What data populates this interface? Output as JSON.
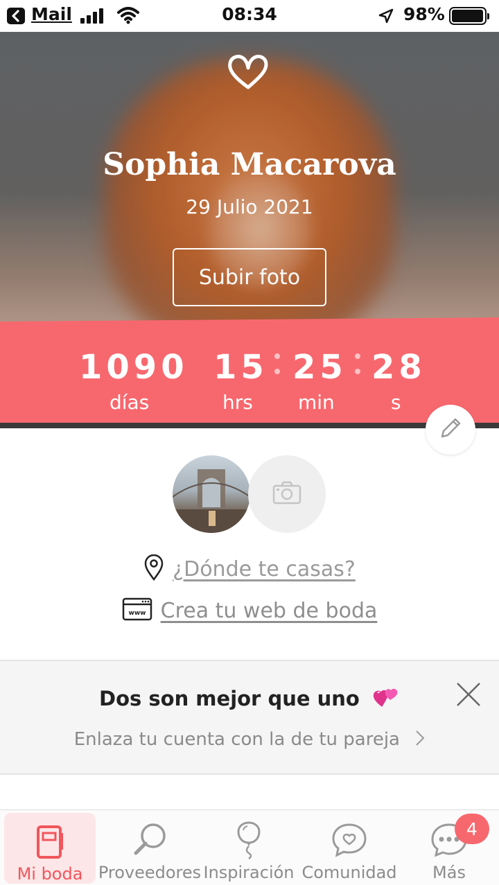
{
  "status_bar": {
    "back_app": "Mail",
    "time": "08:34",
    "battery": "98%",
    "battery_level": 0.98,
    "icons": [
      "back-arrow-icon",
      "signal-icon",
      "wifi-icon",
      "location-arrow-icon",
      "battery-icon"
    ]
  },
  "hero": {
    "name": "Sophia Macarova",
    "date": "29 Julio 2021",
    "upload_button": "Subir foto",
    "icon": "heart-outline-icon"
  },
  "countdown": {
    "days": "1090",
    "hours": "15",
    "minutes": "25",
    "seconds": "28",
    "days_label": "días",
    "hours_label": "hrs",
    "minutes_label": "min",
    "seconds_label": "s",
    "accent": "#f7686e"
  },
  "profile": {
    "where_link": "¿Dónde te casas?",
    "web_link": "Crea tu web de boda",
    "icons": [
      "pencil-icon",
      "camera-icon",
      "location-pin-icon",
      "browser-window-icon"
    ]
  },
  "banner": {
    "title": "Dos son mejor que uno",
    "subtitle": "Enlaza tu cuenta con la de tu pareja",
    "icons": [
      "hearts-emoji-icon",
      "close-icon",
      "chevron-right-icon"
    ]
  },
  "tabbar": {
    "tabs": [
      {
        "label": "Mi boda",
        "icon": "notebook-icon",
        "active": true
      },
      {
        "label": "Proveedores",
        "icon": "magnifier-icon",
        "active": false
      },
      {
        "label": "Inspiración",
        "icon": "balloon-icon",
        "active": false
      },
      {
        "label": "Comunidad",
        "icon": "chat-heart-icon",
        "active": false
      },
      {
        "label": "Más",
        "icon": "more-dots-icon",
        "active": false
      }
    ],
    "more_badge": "4",
    "active_color": "#f0565c"
  }
}
